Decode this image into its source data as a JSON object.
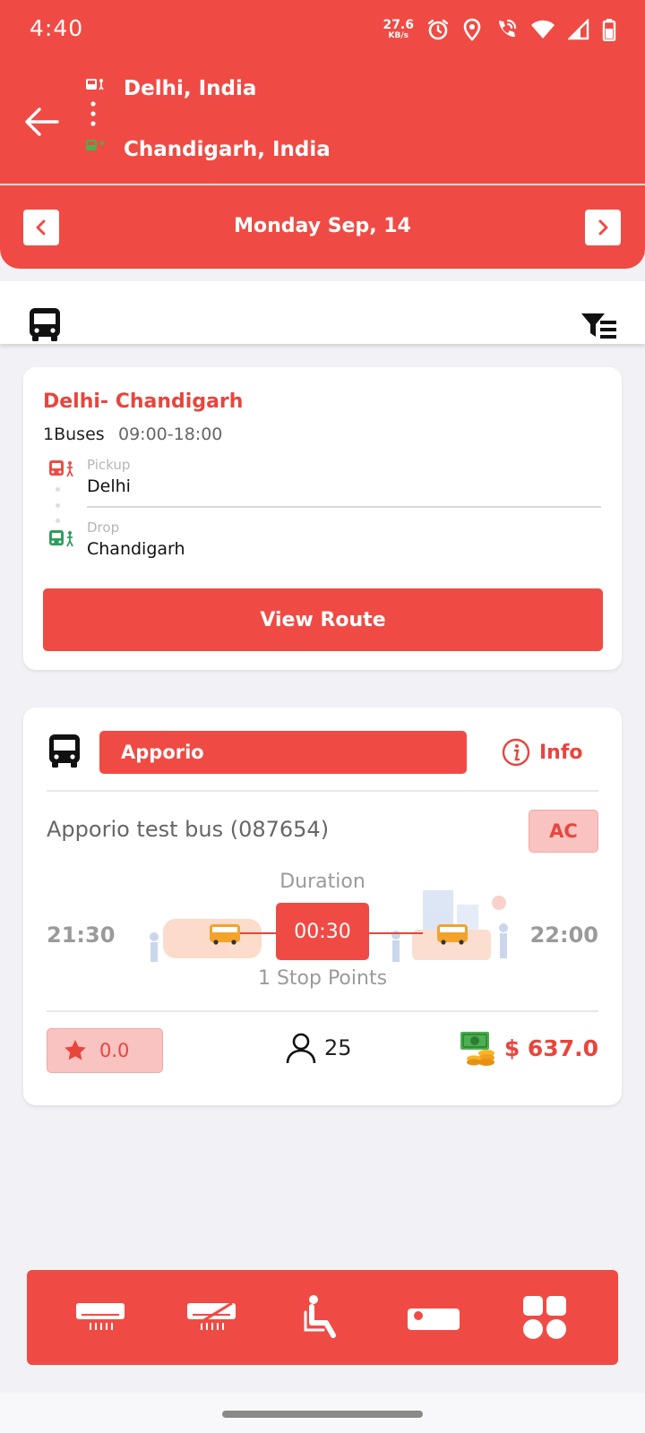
{
  "status_bar": {
    "time": "4:40",
    "net_speed_value": "27.6",
    "net_speed_unit": "KB/s",
    "icons": [
      "alarm-icon",
      "location-icon",
      "wifi-calling-icon",
      "wifi-icon",
      "signal-icon",
      "battery-icon"
    ]
  },
  "header": {
    "from_city": "Delhi, India",
    "to_city": "Chandigarh, India",
    "date": "Monday Sep, 14",
    "accent_color": "#ef4b44"
  },
  "route_card": {
    "title": "Delhi- Chandigarh",
    "buses": "1Buses",
    "time_range": "09:00-18:00",
    "pickup_label": "Pickup",
    "pickup_value": "Delhi",
    "drop_label": "Drop",
    "drop_value": "Chandigarh",
    "view_route_label": "View Route"
  },
  "bus_card": {
    "operator": "Apporio",
    "info_label": "Info",
    "bus_name": "Apporio test bus (087654)",
    "ac_label": "AC",
    "duration_label": "Duration",
    "departure": "21:30",
    "arrival": "22:00",
    "duration": "00:30",
    "stop_points": "1  Stop Points",
    "rating": "0.0",
    "seats": "25",
    "price": "$ 637.0"
  },
  "amenities": [
    "ac-icon",
    "non-ac-icon",
    "seater-icon",
    "sleeper-icon",
    "all-categories-icon"
  ]
}
